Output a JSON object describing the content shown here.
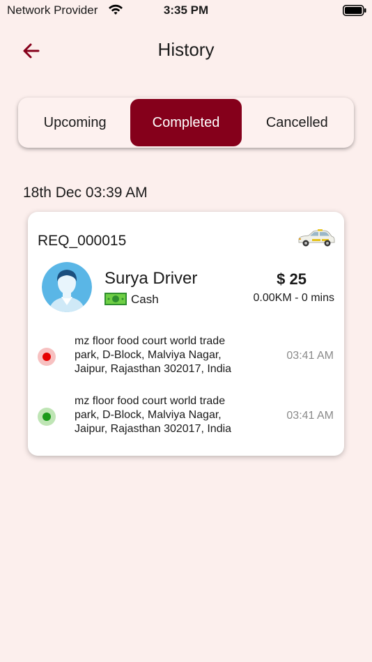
{
  "status_bar": {
    "carrier": "Network Provider",
    "time": "3:35 PM"
  },
  "header": {
    "title": "History",
    "back_icon": "arrow-left-icon"
  },
  "tabs": [
    {
      "label": "Upcoming",
      "active": false
    },
    {
      "label": "Completed",
      "active": true
    },
    {
      "label": "Cancelled",
      "active": false
    }
  ],
  "colors": {
    "accent": "#85001b",
    "background": "#fcefed",
    "pickup": "#e60000",
    "drop": "#1b9a1b"
  },
  "rides": [
    {
      "date": "18th Dec 03:39 AM",
      "request_id": "REQ_000015",
      "vehicle_icon": "car-icon",
      "driver_name": "Surya Driver",
      "payment_method": "Cash",
      "fare": "$ 25",
      "distance_duration": "0.00KM - 0 mins",
      "pickup": {
        "address": "mz floor food court world trade park, D-Block, Malviya Nagar, Jaipur, Rajasthan 302017, India",
        "time": "03:41 AM"
      },
      "drop": {
        "address": "mz floor food court world trade park, D-Block, Malviya Nagar, Jaipur, Rajasthan 302017, India",
        "time": "03:41 AM"
      }
    }
  ]
}
